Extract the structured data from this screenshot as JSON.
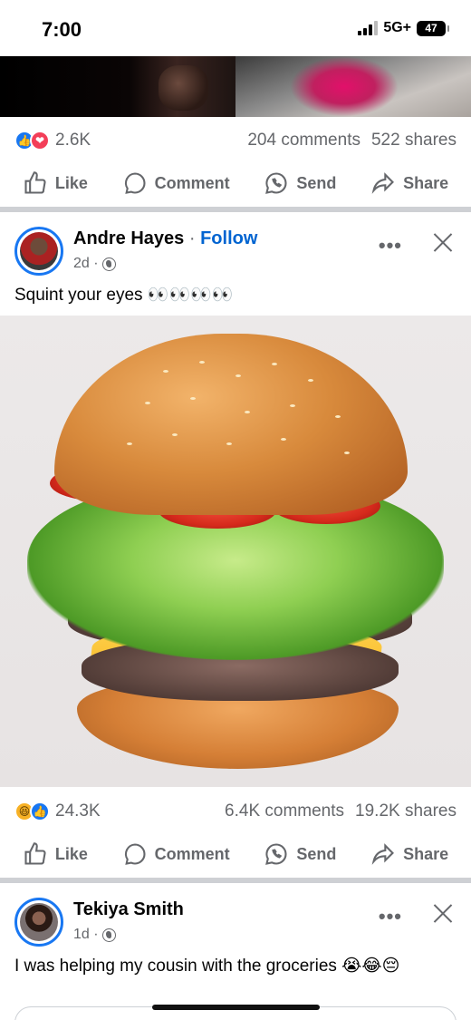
{
  "status_bar": {
    "time": "7:00",
    "network": "5G+",
    "battery": "47"
  },
  "previous_post": {
    "reaction_count": "2.6K",
    "comments": "204 comments",
    "shares": "522 shares",
    "reaction_icons": [
      "like-icon",
      "love-icon"
    ]
  },
  "actions": {
    "like": "Like",
    "comment": "Comment",
    "send": "Send",
    "share": "Share"
  },
  "post1": {
    "author": "Andre Hayes",
    "separator": "·",
    "follow": "Follow",
    "time": "2d ·",
    "text": "Squint your eyes 👀👀👀👀",
    "reaction_count": "24.3K",
    "comments": "6.4K comments",
    "shares": "19.2K shares",
    "reaction_icons": [
      "haha-icon",
      "like-icon"
    ]
  },
  "post2": {
    "author": "Tekiya Smith",
    "time": "1d ·",
    "text": "I was helping my cousin with the groceries 😭😂😔"
  },
  "colors": {
    "facebook_blue": "#1877f2",
    "follow_blue": "#0064d1",
    "secondary_text": "#65676b",
    "divider": "#ced0d4"
  }
}
